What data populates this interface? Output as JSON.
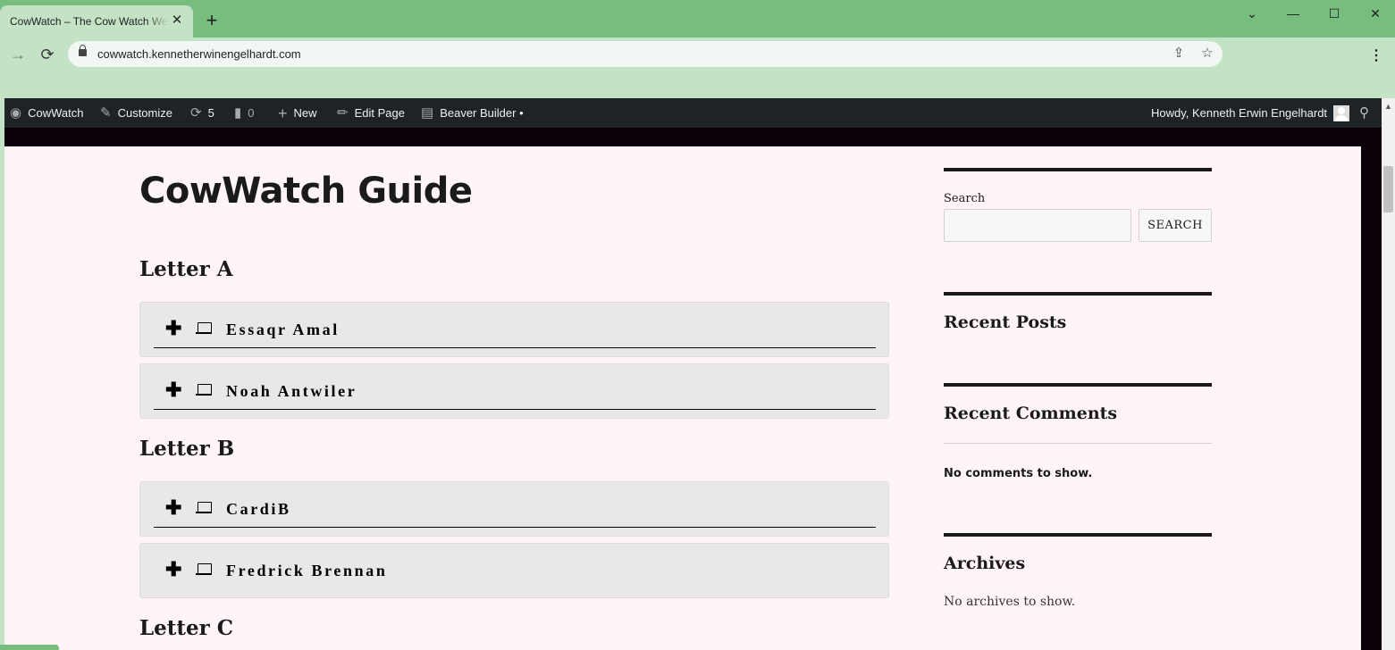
{
  "browser": {
    "tab_title": "CowWatch – The Cow Watch Web",
    "tab_close": "✕",
    "new_tab": "+",
    "url": "cowwatch.kennetherwinengelhardt.com",
    "controls": {
      "tab_search": "⌄",
      "minimize": "—",
      "maximize": "☐",
      "close": "✕"
    },
    "nav": {
      "forward": "→",
      "reload": "⟳"
    },
    "omnibox_icons": {
      "share": "⇪",
      "bookmark": "☆"
    },
    "menu": "⋮"
  },
  "adminbar": {
    "site_name": "CowWatch",
    "customize": "Customize",
    "updates_count": "5",
    "comments_count": "0",
    "new_label": "New",
    "edit_page": "Edit Page",
    "beaver_builder": "Beaver Builder •",
    "howdy": "Howdy, Kenneth Erwin Engelhardt",
    "icons": {
      "dashboard": "dashboard-icon",
      "customize": "brush-icon",
      "updates": "updates-icon",
      "comments": "comment-icon",
      "new": "plus-icon",
      "edit": "pencil-icon",
      "builder": "layout-icon",
      "search": "search-icon"
    }
  },
  "main": {
    "title": "CowWatch Guide",
    "sections": [
      {
        "heading": "Letter A",
        "items": [
          {
            "label": "Essaqr Amal"
          },
          {
            "label": "Noah Antwiler"
          }
        ]
      },
      {
        "heading": "Letter B",
        "items": [
          {
            "label": "CardiB"
          },
          {
            "label": "Fredrick Brennan"
          }
        ]
      },
      {
        "heading": "Letter C",
        "items": []
      }
    ]
  },
  "sidebar": {
    "search_label": "Search",
    "search_value": "",
    "search_button": "SEARCH",
    "recent_posts": "Recent Posts",
    "recent_comments": "Recent Comments",
    "no_comments": "No comments to show.",
    "archives": "Archives",
    "no_archives": "No archives to show."
  },
  "colors": {
    "tabbar": "#76bd7e",
    "toolbar": "#c4e2c6",
    "adminbar": "#1d2327",
    "page_bg": "#fff5f8",
    "accordion_bg": "#e8e8e8"
  }
}
